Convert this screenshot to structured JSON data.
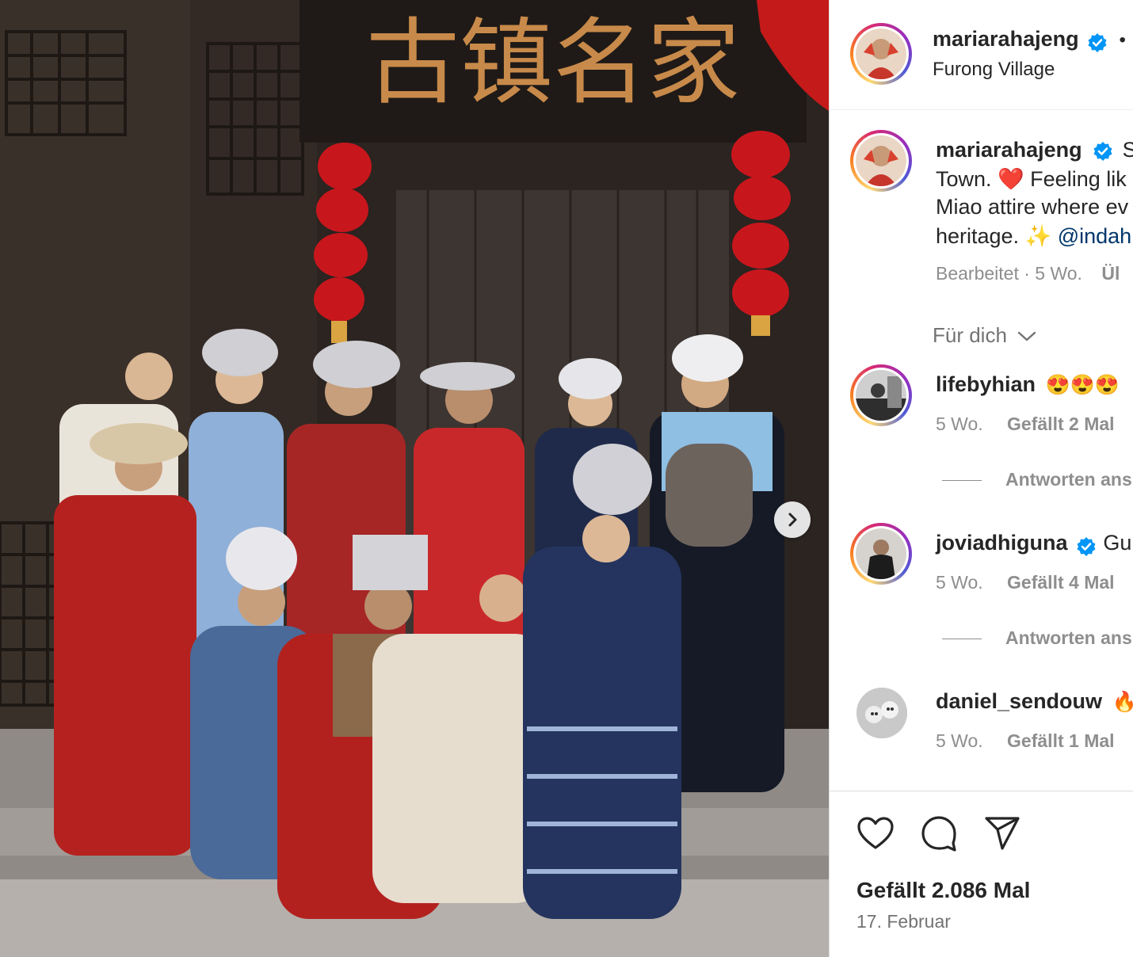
{
  "post": {
    "header": {
      "username": "mariarahajeng",
      "dot": "•",
      "location": "Furong Village"
    },
    "photo_sign_text": "古镇名家",
    "caption": {
      "username": "mariarahajeng",
      "line1_start": "S",
      "line2_text": "Town. ",
      "line2_emoji": "❤️",
      "line2_rest": " Feeling lik",
      "line3": "Miao attire where ev",
      "line4_text": "heritage. ",
      "line4_emoji": "✨",
      "line4_mention": " @indah",
      "meta": "Bearbeitet · 5 Wo.",
      "meta_cut": "Ül"
    },
    "for_you": "Für dich",
    "comments": [
      {
        "username": "lifebyhian",
        "text": "😍😍😍",
        "time": "5 Wo.",
        "likes": "Gefällt 2 Mal",
        "verified": false,
        "replies": "Antworten ans"
      },
      {
        "username": "joviadhiguna",
        "text": "Gu",
        "time": "5 Wo.",
        "likes": "Gefällt 4 Mal",
        "verified": true,
        "replies": "Antworten ans"
      },
      {
        "username": "daniel_sendouw",
        "text": "🔥",
        "time": "5 Wo.",
        "likes": "Gefällt 1 Mal",
        "verified": false
      }
    ],
    "likes_total": "Gefällt 2.086 Mal",
    "date": "17. Februar"
  },
  "icons": {
    "like": "heart-icon",
    "comment": "comment-icon",
    "share": "paper-plane-icon",
    "next": "chevron-right-icon",
    "verified": "verified-badge-icon",
    "dropdown": "chevron-down-icon"
  },
  "colors": {
    "verified_blue": "#0095f6",
    "text_primary": "#262626",
    "text_secondary": "#8e8e8e",
    "link": "#00376b"
  }
}
